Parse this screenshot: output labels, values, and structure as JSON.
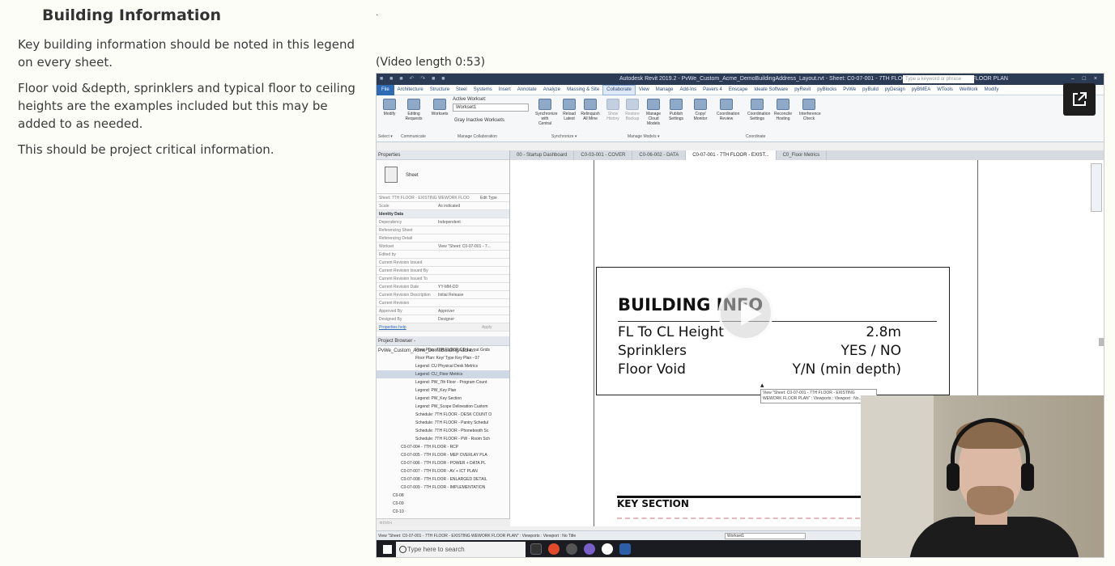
{
  "article": {
    "heading": "Building Information",
    "paragraphs": [
      "Key building information should be noted in this legend on every sheet.",
      "Floor void &depth, sprinklers and typical floor to ceiling heights are the examples included but this may be added to as needed.",
      "This should be project critical information."
    ]
  },
  "dot": ".",
  "video_length": "(Video length 0:53)",
  "video": {
    "window_title": "Autodesk Revit 2019.2 - PvWe_Custom_Acme_DemoBuildingAddress_Layout.rvt - Sheet: C0-07-001 - 7TH FLOOR - EXISTING WEWORK FLOOR PLAN",
    "search_placeholder": "Type a keyword or phrase",
    "quick_access": "■ ■ ■ ↶ ↷ ■ ■",
    "window_controls": "– □ ×",
    "menu": [
      "File",
      "Architecture",
      "Structure",
      "Steel",
      "Systems",
      "Insert",
      "Annotate",
      "Analyze",
      "Massing & Site",
      "Collaborate",
      "View",
      "Manage",
      "Add-Ins",
      "Pavers 4",
      "Enscape",
      "Ideate Software",
      "pyRevit",
      "pyBlocks",
      "PvWe",
      "pyBuild",
      "pyDesign",
      "pyBMEA",
      "WTools",
      "WeWork",
      "Modify"
    ],
    "active_menu": "Collaborate",
    "ribbon": {
      "buttons": [
        "Modify",
        "Editing Requests",
        "Worksets",
        "Synchronize with Central",
        "Reload Latest",
        "Relinquish All Mine",
        "Show History",
        "Restore Backup",
        "Manage Cloud Models",
        "Publish Settings",
        "Copy/ Monitor",
        "Coordination Review",
        "Coordination Settings",
        "Reconcile Hosting",
        "Interference Check"
      ],
      "active_workset_label": "Active Workset:",
      "active_workset": "Workset1",
      "gray_inactive": "Gray Inactive Worksets",
      "groups": [
        "Select ▾",
        "Communicate",
        "Manage Collaboration",
        "Synchronize ▾",
        "Manage Models ▾",
        "Coordinate"
      ]
    },
    "tabs": [
      "00 - Startup Dashboard",
      "C0-03-001 - COVER",
      "C0-06-002 - DATA",
      "C0-07-001 - 7TH FLOOR - EXIST...",
      "C0_Floor Metrics"
    ],
    "active_tab": 3,
    "properties": {
      "header": "Properties",
      "type": "Sheet",
      "selector": "Sheet: 7TH FLOOR - EXISTING WEWORK FLOO",
      "edit_type": "Edit Type",
      "rows": [
        {
          "k": "Scale",
          "v": "As indicated",
          "grp": false
        },
        {
          "k": "Identity Data",
          "v": "",
          "grp": true
        },
        {
          "k": "Dependency",
          "v": "Independent",
          "grp": false
        },
        {
          "k": "Referencing Sheet",
          "v": "",
          "grp": false
        },
        {
          "k": "Referencing Detail",
          "v": "",
          "grp": false
        },
        {
          "k": "Workset",
          "v": "View \"Sheet: C0-07-001 - 7...",
          "grp": false
        },
        {
          "k": "Edited by",
          "v": "",
          "grp": false
        },
        {
          "k": "Current Revision Issued",
          "v": "",
          "grp": false
        },
        {
          "k": "Current Revision Issued By",
          "v": "",
          "grp": false
        },
        {
          "k": "Current Revision Issued To",
          "v": "",
          "grp": false
        },
        {
          "k": "Current Revision Date",
          "v": "YY-MM-DD",
          "grp": false
        },
        {
          "k": "Current Revision Description",
          "v": "Initial Release",
          "grp": false
        },
        {
          "k": "Current Revision",
          "v": "",
          "grp": false
        },
        {
          "k": "Approved By",
          "v": "Approver",
          "grp": false
        },
        {
          "k": "Designed By",
          "v": "Designer",
          "grp": false
        }
      ],
      "help": "Properties help",
      "apply": "Apply"
    },
    "browser": {
      "header": "Project Browser - PvWe_Custom_Acme_DemoBuildingAddre...",
      "items": [
        {
          "t": "Floor Plan: 7TH FLOOR CD Layout Grids",
          "sel": false
        },
        {
          "t": "Floor Plan: Key/ Type Key Plan - 07",
          "sel": false
        },
        {
          "t": "Legend: CU Physical Desk Metrics",
          "sel": false
        },
        {
          "t": "Legend: CU_Floor Metrics",
          "sel": true
        },
        {
          "t": "Legend: PW_7th Floor - Program Count",
          "sel": false
        },
        {
          "t": "Legend: PW_Key Plan",
          "sel": false
        },
        {
          "t": "Legend: PW_Key Section",
          "sel": false
        },
        {
          "t": "Legend: PW_Scope Delineation Custom",
          "sel": false
        },
        {
          "t": "Schedule: 7TH FLOOR - DESK COUNT O",
          "sel": false
        },
        {
          "t": "Schedule: 7TH FLOOR - Pantry Schedul",
          "sel": false
        },
        {
          "t": "Schedule: 7TH FLOOR - Phonebooth Sc",
          "sel": false
        },
        {
          "t": "Schedule: 7TH FLOOR - PW - Room Sch",
          "sel": false
        },
        {
          "t": "C0-07-004 - 7TH FLOOR - RCP",
          "sel": false
        },
        {
          "t": "C0-07-005 - 7TH FLOOR - MEP OVERLAY PLA",
          "sel": false
        },
        {
          "t": "C0-07-006 - 7TH FLOOR - POWER + DATA PL",
          "sel": false
        },
        {
          "t": "C0-07-007 - 7TH FLOOR - AV + ICT PLAN",
          "sel": false
        },
        {
          "t": "C0-07-008 - 7TH FLOOR - ENLARGED DETAIL",
          "sel": false
        },
        {
          "t": "C0-07-009 - 7TH FLOOR - IMPLEMENTATION",
          "sel": false
        },
        {
          "t": "C0-08",
          "sel": false
        },
        {
          "t": "C0-09",
          "sel": false
        },
        {
          "t": "C0-10",
          "sel": false
        }
      ]
    },
    "legend": {
      "title": "BUILDING INFO",
      "rows": [
        {
          "label": "FL To CL Height",
          "value": "2.8m"
        },
        {
          "label": "Sprinklers",
          "value": "YES / NO"
        },
        {
          "label": "Floor Void",
          "value": "Y/N (min depth)"
        }
      ]
    },
    "tooltip": "View \"Sheet: C0-07-001 - 7TH FLOOR - EXISTING WEWORK FLOOR PLAN\" : Viewports : Viewport : No...",
    "key_section": "KEY SECTION",
    "status_text": "View \"Sheet: C0-07-001 - 7TH FLOOR - EXISTING WEWORK FLOOR PLAN\" : Viewports : Viewport : No Title",
    "status_workset": "Workset1",
    "status_left": "□ □ □ ‹",
    "taskbar_search": "Type here to search"
  }
}
